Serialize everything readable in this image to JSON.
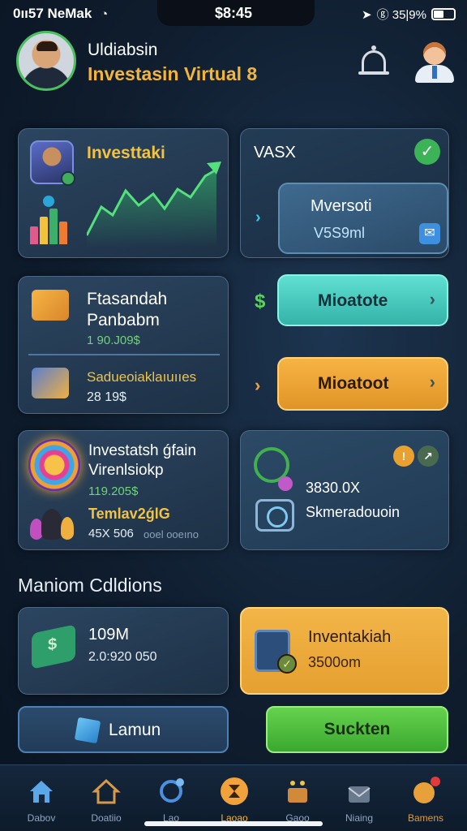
{
  "status_bar": {
    "carrier": "0ıı57 NeMak",
    "time": "$8:45",
    "battery_text": "ⓖ 35|9%"
  },
  "header": {
    "greeting": "Uldiabsin",
    "subtitle": "Investasin Virtual 8"
  },
  "chart_card": {
    "title": "Investtaki"
  },
  "vasx_panel": {
    "title": "VASX",
    "button_title": "Mversoti",
    "button_value": "V5S9ml"
  },
  "fin_card": {
    "title_line1": "Ftasandah",
    "title_line2": "Panbabm",
    "value1": "1 90.J09$",
    "label2": "Sadueoiaklaıuııes",
    "value2": "28 19$"
  },
  "buttons": {
    "teal": "Mioatote",
    "orange": "Mioatoot",
    "lamun": "Lamun",
    "sucken": "Suckten"
  },
  "inv_card": {
    "title_line1": "Investatsh ǵfain",
    "title_line2": "Virenlsiokp",
    "value": "119.205$",
    "label": "Temlav2ǵlG",
    "value2": "45X 506",
    "value3": "ooel ooeıno"
  },
  "stats_card": {
    "value": "3830.0X",
    "label": "Skmeradouoin"
  },
  "section_title": "Maniom Cdldions",
  "money_card": {
    "title": "109M",
    "value": "2.0:920 050"
  },
  "inv_yellow_card": {
    "title": "Inventakiah",
    "value": "3500om"
  },
  "tabs": [
    {
      "label": "Dabov",
      "active": false
    },
    {
      "label": "Doatiio",
      "active": false
    },
    {
      "label": "Lao",
      "active": false
    },
    {
      "label": "Laoao",
      "active": true
    },
    {
      "label": "Gaoo",
      "active": false
    },
    {
      "label": "Niaing",
      "active": false
    },
    {
      "label": "Bamens",
      "active": false
    }
  ],
  "colors": {
    "accent_green": "#4ac060",
    "accent_orange": "#f2b53a",
    "accent_teal": "#5fe0d2",
    "background": "#0f1d2e"
  }
}
